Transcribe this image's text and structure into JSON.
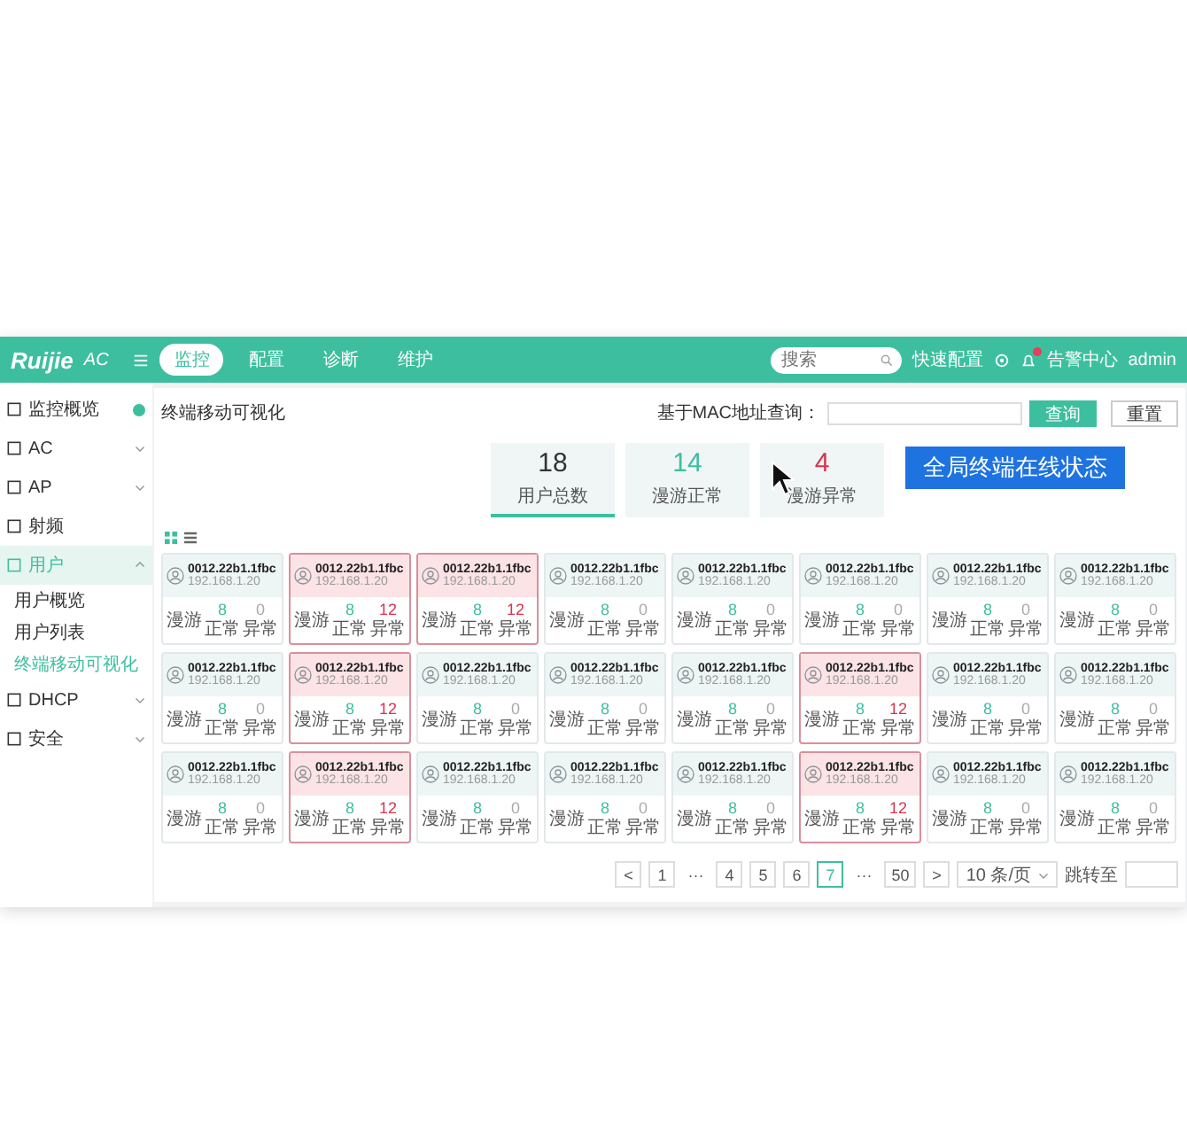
{
  "header": {
    "logo": "Ruijie",
    "product": "AC",
    "nav": [
      {
        "label": "监控",
        "selected": true
      },
      {
        "label": "配置",
        "selected": false
      },
      {
        "label": "诊断",
        "selected": false
      },
      {
        "label": "维护",
        "selected": false
      }
    ],
    "search": {
      "placeholder": "搜索"
    },
    "quick_config": "快速配置",
    "alerts": "告警中心",
    "user": "admin"
  },
  "sidebar": {
    "items": [
      {
        "label": "监控概览",
        "badge": true,
        "selected": false
      },
      {
        "label": "AC",
        "selected": false,
        "expanded": false
      },
      {
        "label": "AP",
        "selected": false,
        "expanded": false
      },
      {
        "label": "射频",
        "selected": false
      },
      {
        "label": "用户",
        "selected": true,
        "expanded": true,
        "children": [
          {
            "label": "用户概览",
            "selected": false
          },
          {
            "label": "用户列表",
            "selected": false
          },
          {
            "label": "终端移动可视化",
            "selected": true
          }
        ]
      },
      {
        "label": "DHCP",
        "selected": false,
        "expanded": false
      },
      {
        "label": "安全",
        "selected": false,
        "expanded": false
      }
    ]
  },
  "page": {
    "title": "终端移动可视化",
    "query_label": "基于MAC地址查询：",
    "query_button": "查询",
    "reset_button": "重置"
  },
  "stats": [
    {
      "value": "18",
      "label": "用户总数",
      "selected": true,
      "kind": "total"
    },
    {
      "value": "14",
      "label": "漫游正常",
      "selected": false,
      "kind": "ok"
    },
    {
      "value": "4",
      "label": "漫游异常",
      "selected": false,
      "kind": "bad"
    }
  ],
  "annotation": "全局终端在线状态",
  "view_modes": [
    {
      "kind": "grid",
      "selected": true
    },
    {
      "kind": "list",
      "selected": false
    }
  ],
  "cards": [
    {
      "mac": "0012.22b1.1fbc",
      "ip": "192.168.1.20",
      "label": "漫游",
      "ok": "8",
      "ok_label": "正常",
      "bad": "0",
      "bad_label": "异常",
      "abnormal": false
    },
    {
      "mac": "0012.22b1.1fbc",
      "ip": "192.168.1.20",
      "label": "漫游",
      "ok": "8",
      "ok_label": "正常",
      "bad": "12",
      "bad_label": "异常",
      "abnormal": true
    },
    {
      "mac": "0012.22b1.1fbc",
      "ip": "192.168.1.20",
      "label": "漫游",
      "ok": "8",
      "ok_label": "正常",
      "bad": "12",
      "bad_label": "异常",
      "abnormal": true
    },
    {
      "mac": "0012.22b1.1fbc",
      "ip": "192.168.1.20",
      "label": "漫游",
      "ok": "8",
      "ok_label": "正常",
      "bad": "0",
      "bad_label": "异常",
      "abnormal": false
    },
    {
      "mac": "0012.22b1.1fbc",
      "ip": "192.168.1.20",
      "label": "漫游",
      "ok": "8",
      "ok_label": "正常",
      "bad": "0",
      "bad_label": "异常",
      "abnormal": false
    },
    {
      "mac": "0012.22b1.1fbc",
      "ip": "192.168.1.20",
      "label": "漫游",
      "ok": "8",
      "ok_label": "正常",
      "bad": "0",
      "bad_label": "异常",
      "abnormal": false
    },
    {
      "mac": "0012.22b1.1fbc",
      "ip": "192.168.1.20",
      "label": "漫游",
      "ok": "8",
      "ok_label": "正常",
      "bad": "0",
      "bad_label": "异常",
      "abnormal": false
    },
    {
      "mac": "0012.22b1.1fbc",
      "ip": "192.168.1.20",
      "label": "漫游",
      "ok": "8",
      "ok_label": "正常",
      "bad": "0",
      "bad_label": "异常",
      "abnormal": false
    },
    {
      "mac": "0012.22b1.1fbc",
      "ip": "192.168.1.20",
      "label": "漫游",
      "ok": "8",
      "ok_label": "正常",
      "bad": "0",
      "bad_label": "异常",
      "abnormal": false
    },
    {
      "mac": "0012.22b1.1fbc",
      "ip": "192.168.1.20",
      "label": "漫游",
      "ok": "8",
      "ok_label": "正常",
      "bad": "12",
      "bad_label": "异常",
      "abnormal": true
    },
    {
      "mac": "0012.22b1.1fbc",
      "ip": "192.168.1.20",
      "label": "漫游",
      "ok": "8",
      "ok_label": "正常",
      "bad": "0",
      "bad_label": "异常",
      "abnormal": false
    },
    {
      "mac": "0012.22b1.1fbc",
      "ip": "192.168.1.20",
      "label": "漫游",
      "ok": "8",
      "ok_label": "正常",
      "bad": "0",
      "bad_label": "异常",
      "abnormal": false
    },
    {
      "mac": "0012.22b1.1fbc",
      "ip": "192.168.1.20",
      "label": "漫游",
      "ok": "8",
      "ok_label": "正常",
      "bad": "0",
      "bad_label": "异常",
      "abnormal": false
    },
    {
      "mac": "0012.22b1.1fbc",
      "ip": "192.168.1.20",
      "label": "漫游",
      "ok": "8",
      "ok_label": "正常",
      "bad": "12",
      "bad_label": "异常",
      "abnormal": true
    },
    {
      "mac": "0012.22b1.1fbc",
      "ip": "192.168.1.20",
      "label": "漫游",
      "ok": "8",
      "ok_label": "正常",
      "bad": "0",
      "bad_label": "异常",
      "abnormal": false
    },
    {
      "mac": "0012.22b1.1fbc",
      "ip": "192.168.1.20",
      "label": "漫游",
      "ok": "8",
      "ok_label": "正常",
      "bad": "0",
      "bad_label": "异常",
      "abnormal": false
    },
    {
      "mac": "0012.22b1.1fbc",
      "ip": "192.168.1.20",
      "label": "漫游",
      "ok": "8",
      "ok_label": "正常",
      "bad": "0",
      "bad_label": "异常",
      "abnormal": false
    },
    {
      "mac": "0012.22b1.1fbc",
      "ip": "192.168.1.20",
      "label": "漫游",
      "ok": "8",
      "ok_label": "正常",
      "bad": "12",
      "bad_label": "异常",
      "abnormal": true
    },
    {
      "mac": "0012.22b1.1fbc",
      "ip": "192.168.1.20",
      "label": "漫游",
      "ok": "8",
      "ok_label": "正常",
      "bad": "0",
      "bad_label": "异常",
      "abnormal": false
    },
    {
      "mac": "0012.22b1.1fbc",
      "ip": "192.168.1.20",
      "label": "漫游",
      "ok": "8",
      "ok_label": "正常",
      "bad": "0",
      "bad_label": "异常",
      "abnormal": false
    },
    {
      "mac": "0012.22b1.1fbc",
      "ip": "192.168.1.20",
      "label": "漫游",
      "ok": "8",
      "ok_label": "正常",
      "bad": "0",
      "bad_label": "异常",
      "abnormal": false
    },
    {
      "mac": "0012.22b1.1fbc",
      "ip": "192.168.1.20",
      "label": "漫游",
      "ok": "8",
      "ok_label": "正常",
      "bad": "12",
      "bad_label": "异常",
      "abnormal": true
    },
    {
      "mac": "0012.22b1.1fbc",
      "ip": "192.168.1.20",
      "label": "漫游",
      "ok": "8",
      "ok_label": "正常",
      "bad": "0",
      "bad_label": "异常",
      "abnormal": false
    },
    {
      "mac": "0012.22b1.1fbc",
      "ip": "192.168.1.20",
      "label": "漫游",
      "ok": "8",
      "ok_label": "正常",
      "bad": "0",
      "bad_label": "异常",
      "abnormal": false
    }
  ],
  "pagination": {
    "prev": "<",
    "next": ">",
    "pages": [
      {
        "label": "1",
        "selected": false
      },
      {
        "label": "···",
        "selected": false
      },
      {
        "label": "4",
        "selected": false
      },
      {
        "label": "5",
        "selected": false
      },
      {
        "label": "6",
        "selected": false
      },
      {
        "label": "7",
        "selected": true
      },
      {
        "label": "···",
        "selected": false
      },
      {
        "label": "50",
        "selected": false
      }
    ],
    "page_size": "10 条/页",
    "jump_label": "跳转至"
  }
}
